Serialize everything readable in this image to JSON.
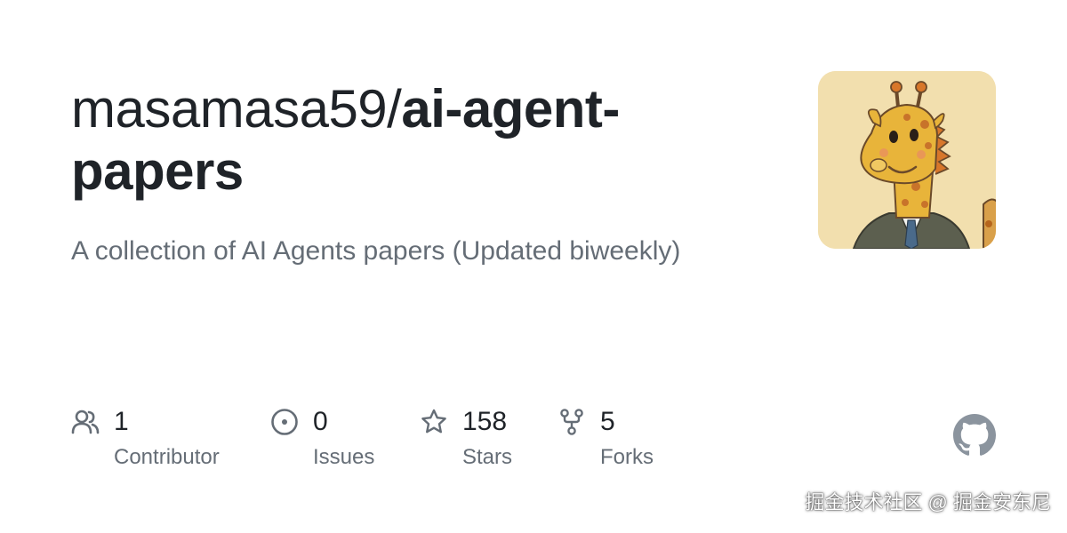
{
  "repo": {
    "owner": "masamasa59/",
    "name": "ai-agent-papers",
    "name_line1": "ai-agent-",
    "name_line2": "papers",
    "description": "A collection of AI Agents papers (Updated biweekly)"
  },
  "avatar": {
    "subject": "cartoon giraffe in suit",
    "background_color": "#f2dfae"
  },
  "stats": [
    {
      "icon": "people-icon",
      "value": "1",
      "label": "Contributor"
    },
    {
      "icon": "issue-circle-icon",
      "value": "0",
      "label": "Issues"
    },
    {
      "icon": "star-icon",
      "value": "158",
      "label": "Stars"
    },
    {
      "icon": "fork-icon",
      "value": "5",
      "label": "Forks"
    }
  ],
  "brand": {
    "logo": "github-icon",
    "logo_color": "#8b949e"
  },
  "watermark": "掘金技术社区 @ 掘金安东尼",
  "colors": {
    "primary_text": "#1f2328",
    "secondary_text": "#656d76",
    "icon": "#656d76"
  }
}
